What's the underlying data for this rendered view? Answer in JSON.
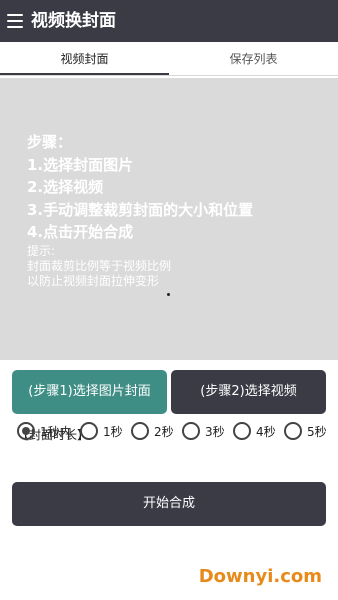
{
  "app": {
    "title": "视频换封面"
  },
  "tabs": [
    {
      "label": "视频封面",
      "selected": true
    },
    {
      "label": "保存列表",
      "selected": false
    }
  ],
  "preview": {
    "steps": [
      "步骤：",
      "1.选择封面图片",
      "2.选择视频",
      "3.手动调整裁剪封面的大小和位置",
      "4.点击开始合成"
    ],
    "hints": [
      "提示:",
      "封面裁剪比例等于视频比例",
      "以防止视频封面拉伸变形"
    ]
  },
  "buttons": {
    "select_image": "(步骤1)选择图片封面",
    "select_video": "(步骤2)选择视频",
    "start": "开始合成"
  },
  "duration": {
    "label": "【封面时长】",
    "options": [
      "1秒内",
      "1秒",
      "2秒",
      "3秒",
      "4秒",
      "5秒"
    ],
    "selected": "1秒内"
  },
  "watermark": "Downyi.com",
  "colors": {
    "appbar": "#3a3b44",
    "accent_button": "#3f8e85",
    "dark_button": "#3a3b44",
    "preview_bg": "#dadada",
    "watermark": "#e88a1a"
  }
}
